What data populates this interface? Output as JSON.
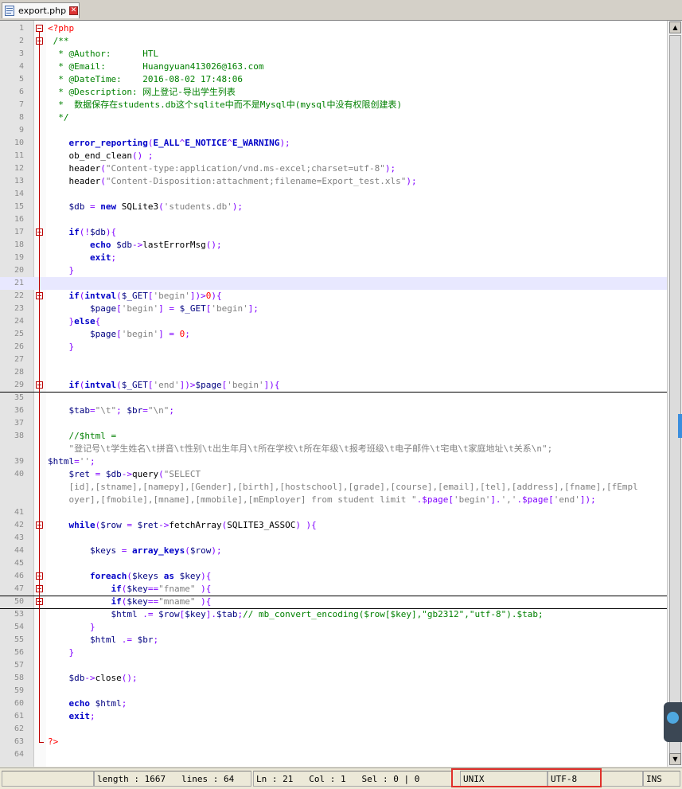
{
  "tab": {
    "filename": "export.php",
    "icon": "php-file-icon",
    "close_icon": "close-icon"
  },
  "colors": {
    "keyword": "#0000c8",
    "string": "#808080",
    "comment": "#008000",
    "number": "#ff0000",
    "highlight": "#e8e8ff",
    "annotation": "#e0302a"
  },
  "lines": [
    {
      "n": "1",
      "code": [
        [
          "t",
          "<?php"
        ]
      ],
      "fold": "minus"
    },
    {
      "n": "2",
      "code": [
        [
          "c",
          " /**"
        ]
      ],
      "fold": "minus"
    },
    {
      "n": "3",
      "code": [
        [
          "c",
          "  * @Author:      HTL"
        ]
      ]
    },
    {
      "n": "4",
      "code": [
        [
          "c",
          "  * @Email:       Huangyuan413026@163.com"
        ]
      ]
    },
    {
      "n": "5",
      "code": [
        [
          "c",
          "  * @DateTime:    2016-08-02 17:48:06"
        ]
      ]
    },
    {
      "n": "6",
      "code": [
        [
          "c",
          "  * @Description: 网上登记-导出学生列表"
        ]
      ]
    },
    {
      "n": "7",
      "code": [
        [
          "c",
          "  *  数据保存在students.db这个sqlite中而不是Mysql中(mysql中没有权限创建表)"
        ]
      ]
    },
    {
      "n": "8",
      "code": [
        [
          "c",
          "  */"
        ]
      ]
    },
    {
      "n": "9",
      "code": []
    },
    {
      "n": "10",
      "code": [
        [
          "k",
          "    error_reporting"
        ],
        [
          "p",
          "("
        ],
        [
          "k",
          "E_ALL"
        ],
        [
          "p",
          "^"
        ],
        [
          "k",
          "E_NOTICE"
        ],
        [
          "p",
          "^"
        ],
        [
          "k",
          "E_WARNING"
        ],
        [
          "p",
          ");"
        ]
      ]
    },
    {
      "n": "11",
      "code": [
        [
          "f",
          "    ob_end_clean"
        ],
        [
          "p",
          "() ;"
        ]
      ]
    },
    {
      "n": "12",
      "code": [
        [
          "f",
          "    header"
        ],
        [
          "p",
          "("
        ],
        [
          "s",
          "\"Content-type:application/vnd.ms-excel;charset=utf-8\""
        ],
        [
          "p",
          ");"
        ]
      ]
    },
    {
      "n": "13",
      "code": [
        [
          "f",
          "    header"
        ],
        [
          "p",
          "("
        ],
        [
          "s",
          "\"Content-Disposition:attachment;filename=Export_test.xls\""
        ],
        [
          "p",
          ");"
        ]
      ]
    },
    {
      "n": "14",
      "code": []
    },
    {
      "n": "15",
      "code": [
        [
          "v",
          "    $db"
        ],
        [
          "p",
          " = "
        ],
        [
          "k",
          "new"
        ],
        [
          "f",
          " SQLite3"
        ],
        [
          "p",
          "("
        ],
        [
          "s",
          "'students.db'"
        ],
        [
          "p",
          ");"
        ]
      ]
    },
    {
      "n": "16",
      "code": []
    },
    {
      "n": "17",
      "code": [
        [
          "k",
          "    if"
        ],
        [
          "p",
          "(!"
        ],
        [
          "v",
          "$db"
        ],
        [
          "p",
          "){"
        ]
      ],
      "fold": "minus"
    },
    {
      "n": "18",
      "code": [
        [
          "k",
          "        echo"
        ],
        [
          "v",
          " $db"
        ],
        [
          "p",
          "->"
        ],
        [
          "f",
          "lastErrorMsg"
        ],
        [
          "p",
          "();"
        ]
      ]
    },
    {
      "n": "19",
      "code": [
        [
          "k",
          "        exit"
        ],
        [
          "p",
          ";"
        ]
      ]
    },
    {
      "n": "20",
      "code": [
        [
          "p",
          "    }"
        ]
      ]
    },
    {
      "n": "21",
      "code": [],
      "current": true
    },
    {
      "n": "22",
      "code": [
        [
          "k",
          "    if"
        ],
        [
          "p",
          "("
        ],
        [
          "k",
          "intval"
        ],
        [
          "p",
          "("
        ],
        [
          "v",
          "$_GET"
        ],
        [
          "p",
          "["
        ],
        [
          "s",
          "'begin'"
        ],
        [
          "p",
          "])>"
        ],
        [
          "n",
          "0"
        ],
        [
          "p",
          "){"
        ]
      ],
      "fold": "minus"
    },
    {
      "n": "23",
      "code": [
        [
          "v",
          "        $page"
        ],
        [
          "p",
          "["
        ],
        [
          "s",
          "'begin'"
        ],
        [
          "p",
          "] = "
        ],
        [
          "v",
          "$_GET"
        ],
        [
          "p",
          "["
        ],
        [
          "s",
          "'begin'"
        ],
        [
          "p",
          "];"
        ]
      ]
    },
    {
      "n": "24",
      "code": [
        [
          "p",
          "    }"
        ],
        [
          "k",
          "else"
        ],
        [
          "p",
          "{"
        ]
      ]
    },
    {
      "n": "25",
      "code": [
        [
          "v",
          "        $page"
        ],
        [
          "p",
          "["
        ],
        [
          "s",
          "'begin'"
        ],
        [
          "p",
          "] = "
        ],
        [
          "n",
          "0"
        ],
        [
          "p",
          ";"
        ]
      ]
    },
    {
      "n": "26",
      "code": [
        [
          "p",
          "    }"
        ]
      ]
    },
    {
      "n": "27",
      "code": []
    },
    {
      "n": "28",
      "code": []
    },
    {
      "n": "29",
      "code": [
        [
          "k",
          "    if"
        ],
        [
          "p",
          "("
        ],
        [
          "k",
          "intval"
        ],
        [
          "p",
          "("
        ],
        [
          "v",
          "$_GET"
        ],
        [
          "p",
          "["
        ],
        [
          "s",
          "'end'"
        ],
        [
          "p",
          "])>"
        ],
        [
          "v",
          "$page"
        ],
        [
          "p",
          "["
        ],
        [
          "s",
          "'begin'"
        ],
        [
          "p",
          "]){"
        ]
      ],
      "fold": "plus",
      "sep": true
    },
    {
      "n": "35",
      "code": []
    },
    {
      "n": "36",
      "code": [
        [
          "v",
          "    $tab"
        ],
        [
          "p",
          "="
        ],
        [
          "s",
          "\"\\t\""
        ],
        [
          "p",
          "; "
        ],
        [
          "v",
          "$br"
        ],
        [
          "p",
          "="
        ],
        [
          "s",
          "\"\\n\""
        ],
        [
          "p",
          ";"
        ]
      ]
    },
    {
      "n": "37",
      "code": []
    },
    {
      "n": "38",
      "code": [
        [
          "c",
          "    //$html ="
        ]
      ]
    },
    {
      "n": "",
      "code": [
        [
          "s",
          "    \"登记号\\t学生姓名\\t拼音\\t性别\\t出生年月\\t所在学校\\t所在年级\\t报考班级\\t电子邮件\\t宅电\\t家庭地址\\t关系\\n\";"
        ]
      ]
    },
    {
      "n": "39",
      "code": [
        [
          "v",
          "$html"
        ],
        [
          "p",
          "="
        ],
        [
          "s",
          "''"
        ],
        [
          "p",
          ";"
        ]
      ]
    },
    {
      "n": "40",
      "code": [
        [
          "v",
          "    $ret"
        ],
        [
          "p",
          " = "
        ],
        [
          "v",
          "$db"
        ],
        [
          "p",
          "->"
        ],
        [
          "f",
          "query"
        ],
        [
          "p",
          "("
        ],
        [
          "s",
          "\"SELECT"
        ]
      ]
    },
    {
      "n": "",
      "code": [
        [
          "s",
          "    [id],[stname],[namepy],[Gender],[birth],[hostschool],[grade],[course],[email],[tel],[address],[fname],[fEmpl"
        ]
      ]
    },
    {
      "n": "",
      "code": [
        [
          "s",
          "    oyer],[fmobile],[mname],[mmobile],[mEmployer] from student limit \""
        ],
        [
          "p",
          ".$page["
        ],
        [
          "s",
          "'begin'"
        ],
        [
          "p",
          "]."
        ],
        [
          "s",
          "','"
        ],
        [
          "p",
          ".$page["
        ],
        [
          "s",
          "'end'"
        ],
        [
          "p",
          "]);"
        ]
      ]
    },
    {
      "n": "41",
      "code": []
    },
    {
      "n": "42",
      "code": [
        [
          "k",
          "    while"
        ],
        [
          "p",
          "("
        ],
        [
          "v",
          "$row"
        ],
        [
          "p",
          " = "
        ],
        [
          "v",
          "$ret"
        ],
        [
          "p",
          "->"
        ],
        [
          "f",
          "fetchArray"
        ],
        [
          "p",
          "("
        ],
        [
          "f",
          "SQLITE3_ASSOC"
        ],
        [
          "p",
          ") ){"
        ]
      ],
      "fold": "minus"
    },
    {
      "n": "43",
      "code": []
    },
    {
      "n": "44",
      "code": [
        [
          "v",
          "        $keys"
        ],
        [
          "p",
          " = "
        ],
        [
          "k",
          "array_keys"
        ],
        [
          "p",
          "("
        ],
        [
          "v",
          "$row"
        ],
        [
          "p",
          ");"
        ]
      ]
    },
    {
      "n": "45",
      "code": []
    },
    {
      "n": "46",
      "code": [
        [
          "k",
          "        foreach"
        ],
        [
          "p",
          "("
        ],
        [
          "v",
          "$keys"
        ],
        [
          "k",
          " as"
        ],
        [
          "v",
          " $key"
        ],
        [
          "p",
          "){"
        ]
      ],
      "fold": "minus"
    },
    {
      "n": "47",
      "code": [
        [
          "k",
          "            if"
        ],
        [
          "p",
          "("
        ],
        [
          "v",
          "$key"
        ],
        [
          "p",
          "=="
        ],
        [
          "s",
          "\"fname\""
        ],
        [
          "p",
          " ){"
        ]
      ],
      "fold": "plus",
      "sep": true
    },
    {
      "n": "50",
      "code": [
        [
          "k",
          "            if"
        ],
        [
          "p",
          "("
        ],
        [
          "v",
          "$key"
        ],
        [
          "p",
          "=="
        ],
        [
          "s",
          "\"mname\""
        ],
        [
          "p",
          " ){"
        ]
      ],
      "fold": "plus",
      "sep": true
    },
    {
      "n": "53",
      "code": [
        [
          "v",
          "            $html"
        ],
        [
          "p",
          " .= "
        ],
        [
          "v",
          "$row"
        ],
        [
          "p",
          "["
        ],
        [
          "v",
          "$key"
        ],
        [
          "p",
          "]."
        ],
        [
          "v",
          "$tab"
        ],
        [
          "p",
          ";"
        ],
        [
          "c",
          "// mb_convert_encoding($row[$key],\"gb2312\",\"utf-8\").$tab;"
        ]
      ]
    },
    {
      "n": "54",
      "code": [
        [
          "p",
          "        }"
        ]
      ]
    },
    {
      "n": "55",
      "code": [
        [
          "v",
          "        $html"
        ],
        [
          "p",
          " .= "
        ],
        [
          "v",
          "$br"
        ],
        [
          "p",
          ";"
        ]
      ]
    },
    {
      "n": "56",
      "code": [
        [
          "p",
          "    }"
        ]
      ]
    },
    {
      "n": "57",
      "code": []
    },
    {
      "n": "58",
      "code": [
        [
          "v",
          "    $db"
        ],
        [
          "p",
          "->"
        ],
        [
          "f",
          "close"
        ],
        [
          "p",
          "();"
        ]
      ]
    },
    {
      "n": "59",
      "code": []
    },
    {
      "n": "60",
      "code": [
        [
          "k",
          "    echo"
        ],
        [
          "v",
          " $html"
        ],
        [
          "p",
          ";"
        ]
      ]
    },
    {
      "n": "61",
      "code": [
        [
          "k",
          "    exit"
        ],
        [
          "p",
          ";"
        ]
      ]
    },
    {
      "n": "62",
      "code": []
    },
    {
      "n": "63",
      "code": [
        [
          "t",
          "?>"
        ]
      ]
    },
    {
      "n": "64",
      "code": []
    }
  ],
  "status": {
    "length": "length : 1667",
    "lines": "lines : 64",
    "ln": "Ln : 21",
    "col": "Col : 1",
    "sel": "Sel : 0 | 0",
    "eol": "UNIX",
    "encoding": "UTF-8",
    "mode": "INS"
  }
}
